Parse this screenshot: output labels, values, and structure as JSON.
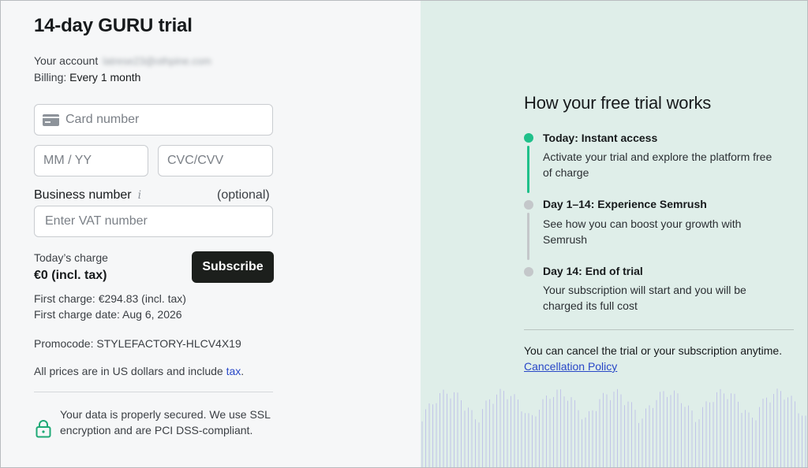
{
  "checkout": {
    "title": "14-day GURU trial",
    "account_label": "Your account",
    "account_email": "latrese23@othpine.com",
    "billing_label": "Billing:",
    "billing_value": "Every 1 month",
    "card_number_placeholder": "Card number",
    "expiry_placeholder": "MM / YY",
    "cvc_placeholder": "CVC/CVV",
    "business_number_label": "Business number",
    "business_info_icon": "i",
    "optional_label": "(optional)",
    "vat_placeholder": "Enter VAT number",
    "todays_charge_label": "Today’s charge",
    "todays_charge_amount": "€0 (incl. tax)",
    "subscribe_label": "Subscribe",
    "first_charge": "First charge: €294.83 (incl. tax)",
    "first_charge_date": "First charge date: Aug 6, 2026",
    "promocode": "Promocode: STYLEFACTORY-HLCV4X19",
    "prices_note": "All prices are in US dollars and include",
    "tax_link": "tax",
    "period": ".",
    "secure_note": "Your data is properly secured. We use SSL encryption and are PCI DSS-compliant."
  },
  "trial_info": {
    "title": "How your free trial works",
    "steps": [
      {
        "title": "Today: Instant access",
        "description": "Activate your trial and explore the platform free of charge",
        "color": "#1fc08a"
      },
      {
        "title": "Day 1–14: Experience Semrush",
        "description": "See how you can boost your growth with Semrush",
        "color": "#c4c7ca"
      },
      {
        "title": "Day 14: End of trial",
        "description": "Your subscription will start and you will be charged its full cost",
        "color": "#c4c7ca"
      }
    ],
    "cancel_text": "You can cancel the trial or your subscription anytime.",
    "cancel_link": "Cancellation Policy"
  },
  "colors": {
    "accent_green": "#1fc08a",
    "right_panel_bg": "#dfeee9",
    "button_dark": "#1c1f1c",
    "link_blue": "#2847c7",
    "wave_purple": "#a7a3e8"
  },
  "icons": {
    "card": "credit-card-icon",
    "info": "info-icon",
    "lock": "lock-icon"
  }
}
